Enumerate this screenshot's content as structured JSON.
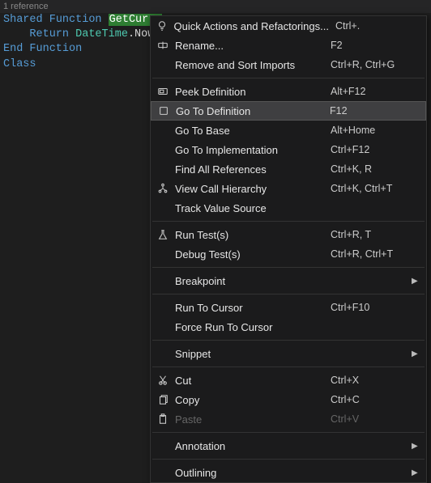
{
  "reference_count": "1 reference",
  "code": {
    "shared": "Shared",
    "function": "Function",
    "fn_name": "GetCurre",
    "return": "Return",
    "datetime": "DateTime",
    "now": "Now",
    "endfn": "End Function",
    "class": "Class"
  },
  "menu": [
    {
      "type": "item",
      "icon": "bulb",
      "label": "Quick Actions and Refactorings...",
      "shortcut": "Ctrl+."
    },
    {
      "type": "item",
      "icon": "rename",
      "label": "Rename...",
      "shortcut": "F2"
    },
    {
      "type": "item",
      "icon": "",
      "label": "Remove and Sort Imports",
      "shortcut": "Ctrl+R, Ctrl+G"
    },
    {
      "type": "sep"
    },
    {
      "type": "item",
      "icon": "peek",
      "label": "Peek Definition",
      "shortcut": "Alt+F12"
    },
    {
      "type": "item",
      "icon": "goto",
      "label": "Go To Definition",
      "shortcut": "F12",
      "highlight": true
    },
    {
      "type": "item",
      "icon": "",
      "label": "Go To Base",
      "shortcut": "Alt+Home"
    },
    {
      "type": "item",
      "icon": "",
      "label": "Go To Implementation",
      "shortcut": "Ctrl+F12"
    },
    {
      "type": "item",
      "icon": "",
      "label": "Find All References",
      "shortcut": "Ctrl+K, R"
    },
    {
      "type": "item",
      "icon": "hierarchy",
      "label": "View Call Hierarchy",
      "shortcut": "Ctrl+K, Ctrl+T"
    },
    {
      "type": "item",
      "icon": "",
      "label": "Track Value Source",
      "shortcut": ""
    },
    {
      "type": "sep"
    },
    {
      "type": "item",
      "icon": "flask",
      "label": "Run Test(s)",
      "shortcut": "Ctrl+R, T"
    },
    {
      "type": "item",
      "icon": "",
      "label": "Debug Test(s)",
      "shortcut": "Ctrl+R, Ctrl+T"
    },
    {
      "type": "sep"
    },
    {
      "type": "item",
      "icon": "",
      "label": "Breakpoint",
      "shortcut": "",
      "submenu": true
    },
    {
      "type": "sep"
    },
    {
      "type": "item",
      "icon": "",
      "label": "Run To Cursor",
      "shortcut": "Ctrl+F10"
    },
    {
      "type": "item",
      "icon": "",
      "label": "Force Run To Cursor",
      "shortcut": ""
    },
    {
      "type": "sep"
    },
    {
      "type": "item",
      "icon": "",
      "label": "Snippet",
      "shortcut": "",
      "submenu": true
    },
    {
      "type": "sep"
    },
    {
      "type": "item",
      "icon": "cut",
      "label": "Cut",
      "shortcut": "Ctrl+X"
    },
    {
      "type": "item",
      "icon": "copy",
      "label": "Copy",
      "shortcut": "Ctrl+C"
    },
    {
      "type": "item",
      "icon": "paste",
      "label": "Paste",
      "shortcut": "Ctrl+V",
      "disabled": true
    },
    {
      "type": "sep"
    },
    {
      "type": "item",
      "icon": "",
      "label": "Annotation",
      "shortcut": "",
      "submenu": true
    },
    {
      "type": "sep"
    },
    {
      "type": "item",
      "icon": "",
      "label": "Outlining",
      "shortcut": "",
      "submenu": true
    }
  ]
}
